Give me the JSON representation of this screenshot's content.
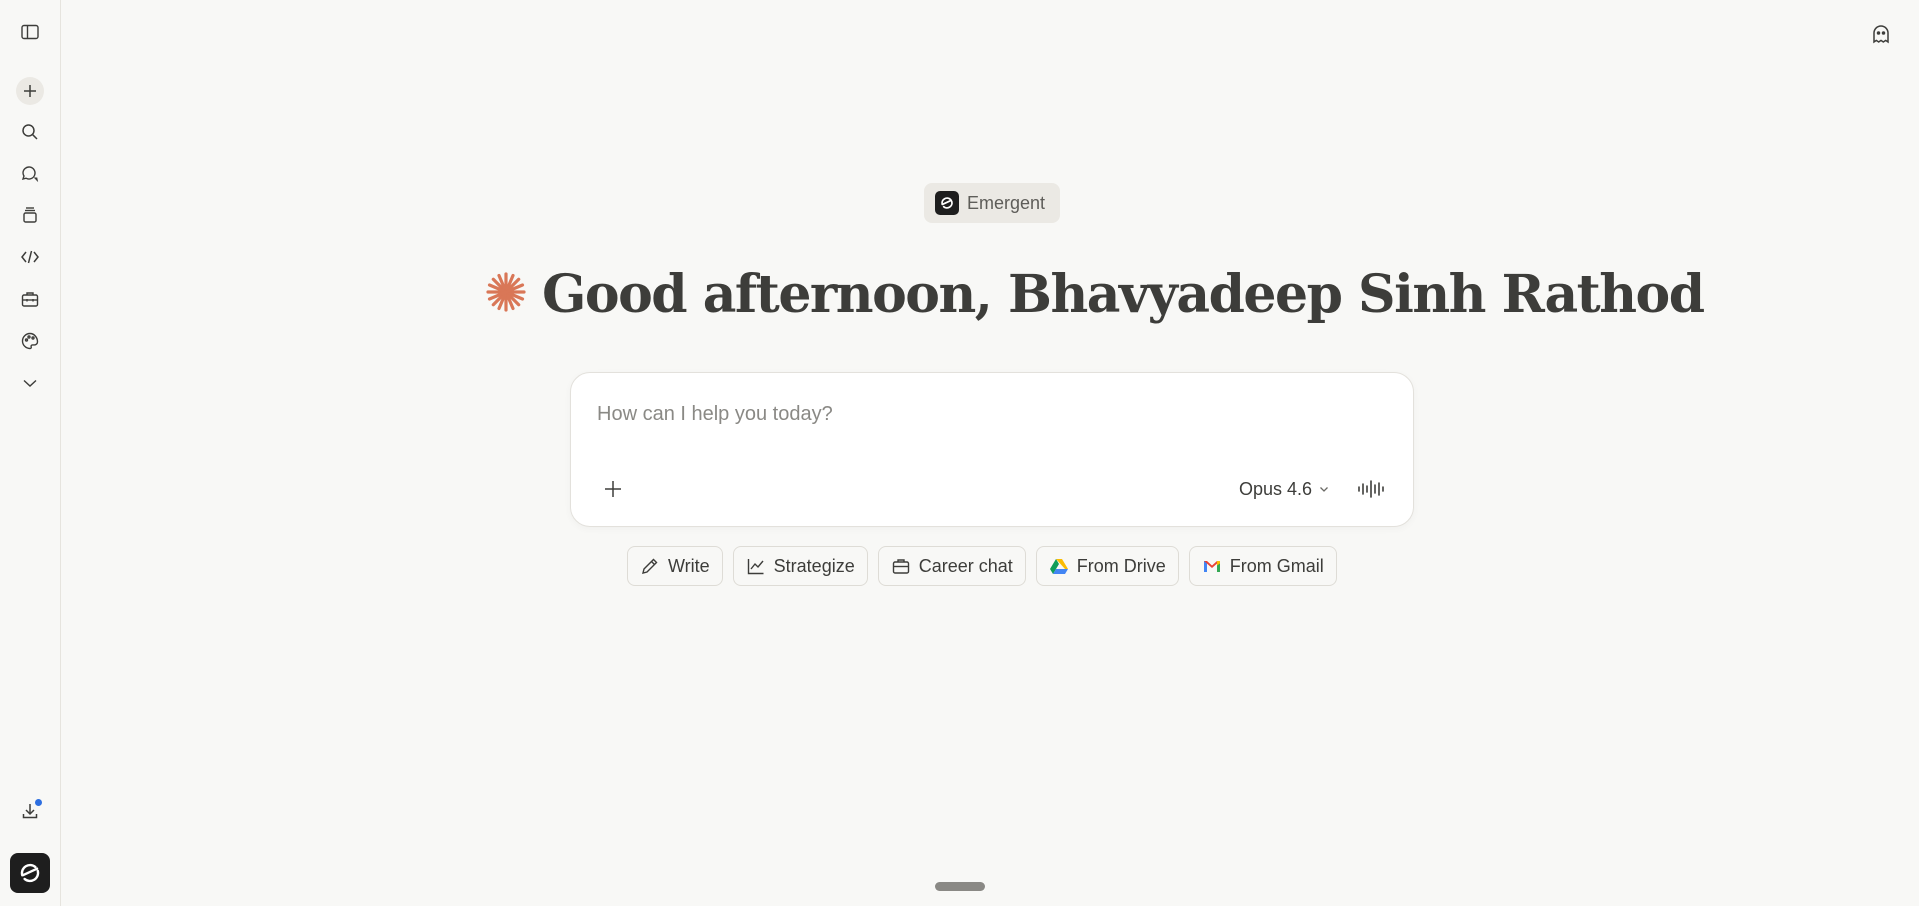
{
  "sidebar": {
    "items": [
      {
        "name": "toggle-sidebar",
        "icon": "sidebar-toggle-icon"
      },
      {
        "name": "new-chat",
        "icon": "plus-icon"
      },
      {
        "name": "search",
        "icon": "search-icon"
      },
      {
        "name": "chats",
        "icon": "chat-bubbles-icon"
      },
      {
        "name": "projects",
        "icon": "stack-icon"
      },
      {
        "name": "code",
        "icon": "code-icon"
      },
      {
        "name": "tools",
        "icon": "toolbox-icon"
      },
      {
        "name": "artifacts",
        "icon": "palette-icon"
      },
      {
        "name": "more",
        "icon": "chevron-down-icon"
      }
    ],
    "download_icon": "download-icon",
    "notify_color": "#2e6fe0",
    "avatar_icon": "emergent-logo-icon"
  },
  "workspace": {
    "label": "Emergent"
  },
  "greeting": {
    "text": "Good afternoon, Bhavyadeep Sinh Rathod",
    "accent": "#d97757"
  },
  "composer": {
    "placeholder": "How can I help you today?",
    "value": "",
    "model": "Opus 4.6"
  },
  "chips": [
    {
      "label": "Write",
      "icon": "pencil-icon"
    },
    {
      "label": "Strategize",
      "icon": "line-chart-icon"
    },
    {
      "label": "Career chat",
      "icon": "briefcase-icon"
    },
    {
      "label": "From Drive",
      "icon": "google-drive-icon"
    },
    {
      "label": "From Gmail",
      "icon": "gmail-icon"
    }
  ],
  "colors": {
    "background": "#f8f8f6",
    "text": "#3d3d3a",
    "muted": "#8a8985"
  }
}
